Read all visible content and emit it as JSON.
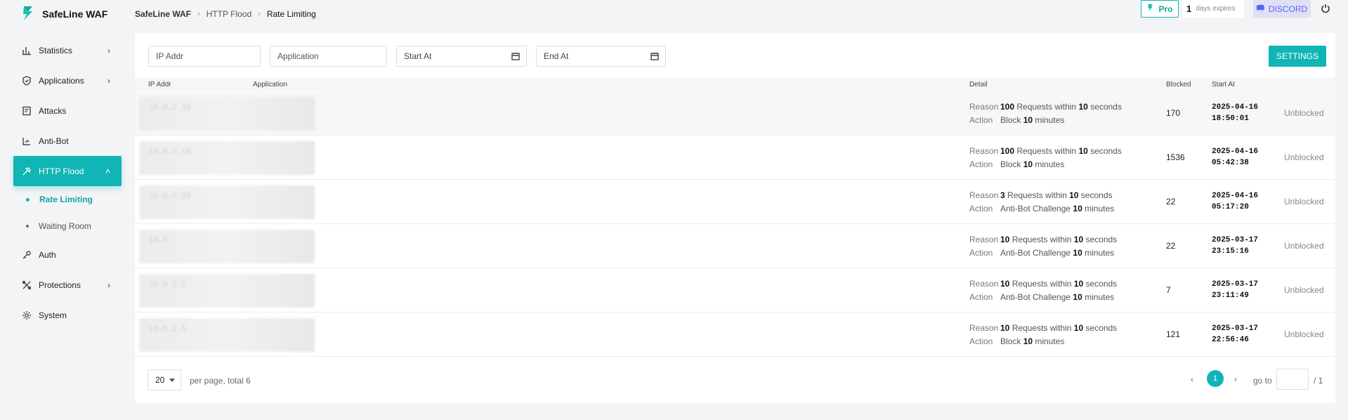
{
  "app": {
    "name": "SafeLine WAF"
  },
  "header": {
    "breadcrumb": [
      "SafeLine WAF",
      "HTTP Flood",
      "Rate Limiting"
    ],
    "pro_label": "Pro",
    "expire_days": "1",
    "expire_label": "days expires",
    "discord_label": "DISCORD"
  },
  "sidebar": {
    "items": [
      {
        "label": "Statistics",
        "icon": "bar-chart-icon"
      },
      {
        "label": "Applications",
        "icon": "shield-icon"
      },
      {
        "label": "Attacks",
        "icon": "document-icon"
      },
      {
        "label": "Anti-Bot",
        "icon": "bot-icon"
      },
      {
        "label": "HTTP Flood",
        "icon": "hammer-icon"
      },
      {
        "label": "Auth",
        "icon": "key-icon"
      },
      {
        "label": "Protections",
        "icon": "tools-icon"
      },
      {
        "label": "System",
        "icon": "gear-icon"
      }
    ],
    "sub_items": [
      {
        "label": "Rate Limiting"
      },
      {
        "label": "Waiting Room"
      }
    ]
  },
  "filters": {
    "ip_placeholder": "IP Addr",
    "app_placeholder": "Application",
    "start_placeholder": "Start At",
    "end_placeholder": "End At",
    "settings_label": "SETTINGS"
  },
  "table": {
    "headers": {
      "ip": "IP Addr",
      "application": "Application",
      "detail": "Detail",
      "blocked": "Blocked",
      "start_at": "Start At"
    },
    "detail_labels": {
      "reason": "Reason",
      "action": "Action",
      "requests_within": "Requests within",
      "seconds": "seconds",
      "minutes": "minutes"
    },
    "rows": [
      {
        "req": "100",
        "win": "10",
        "action": "Block",
        "dur": "10",
        "blocked": "170",
        "date": "2025-04-16",
        "time": "18:50:01",
        "status": "Unblocked",
        "ip_blur": "10.0.2.10"
      },
      {
        "req": "100",
        "win": "10",
        "action": "Block",
        "dur": "10",
        "blocked": "1536",
        "date": "2025-04-16",
        "time": "05:42:38",
        "status": "Unblocked",
        "ip_blur": "10.0.2.10"
      },
      {
        "req": "3",
        "win": "10",
        "action": "Anti-Bot Challenge",
        "dur": "10",
        "blocked": "22",
        "date": "2025-04-16",
        "time": "05:17:20",
        "status": "Unblocked",
        "ip_blur": "10.0.2.10"
      },
      {
        "req": "10",
        "win": "10",
        "action": "Anti-Bot Challenge",
        "dur": "10",
        "blocked": "22",
        "date": "2025-03-17",
        "time": "23:15:16",
        "status": "Unblocked",
        "ip_blur": "10.0."
      },
      {
        "req": "10",
        "win": "10",
        "action": "Anti-Bot Challenge",
        "dur": "10",
        "blocked": "7",
        "date": "2025-03-17",
        "time": "23:11:49",
        "status": "Unblocked",
        "ip_blur": "10.0.2.5"
      },
      {
        "req": "10",
        "win": "10",
        "action": "Block",
        "dur": "10",
        "blocked": "121",
        "date": "2025-03-17",
        "time": "22:56:46",
        "status": "Unblocked",
        "ip_blur": "10.0.2.5"
      }
    ]
  },
  "pagination": {
    "page_size": "20",
    "info": "per page, total 6",
    "current": "1",
    "goto_label": "go to",
    "total_pages": "/ 1"
  },
  "colors": {
    "accent": "#11b5b5",
    "discord": "#5865f2"
  }
}
